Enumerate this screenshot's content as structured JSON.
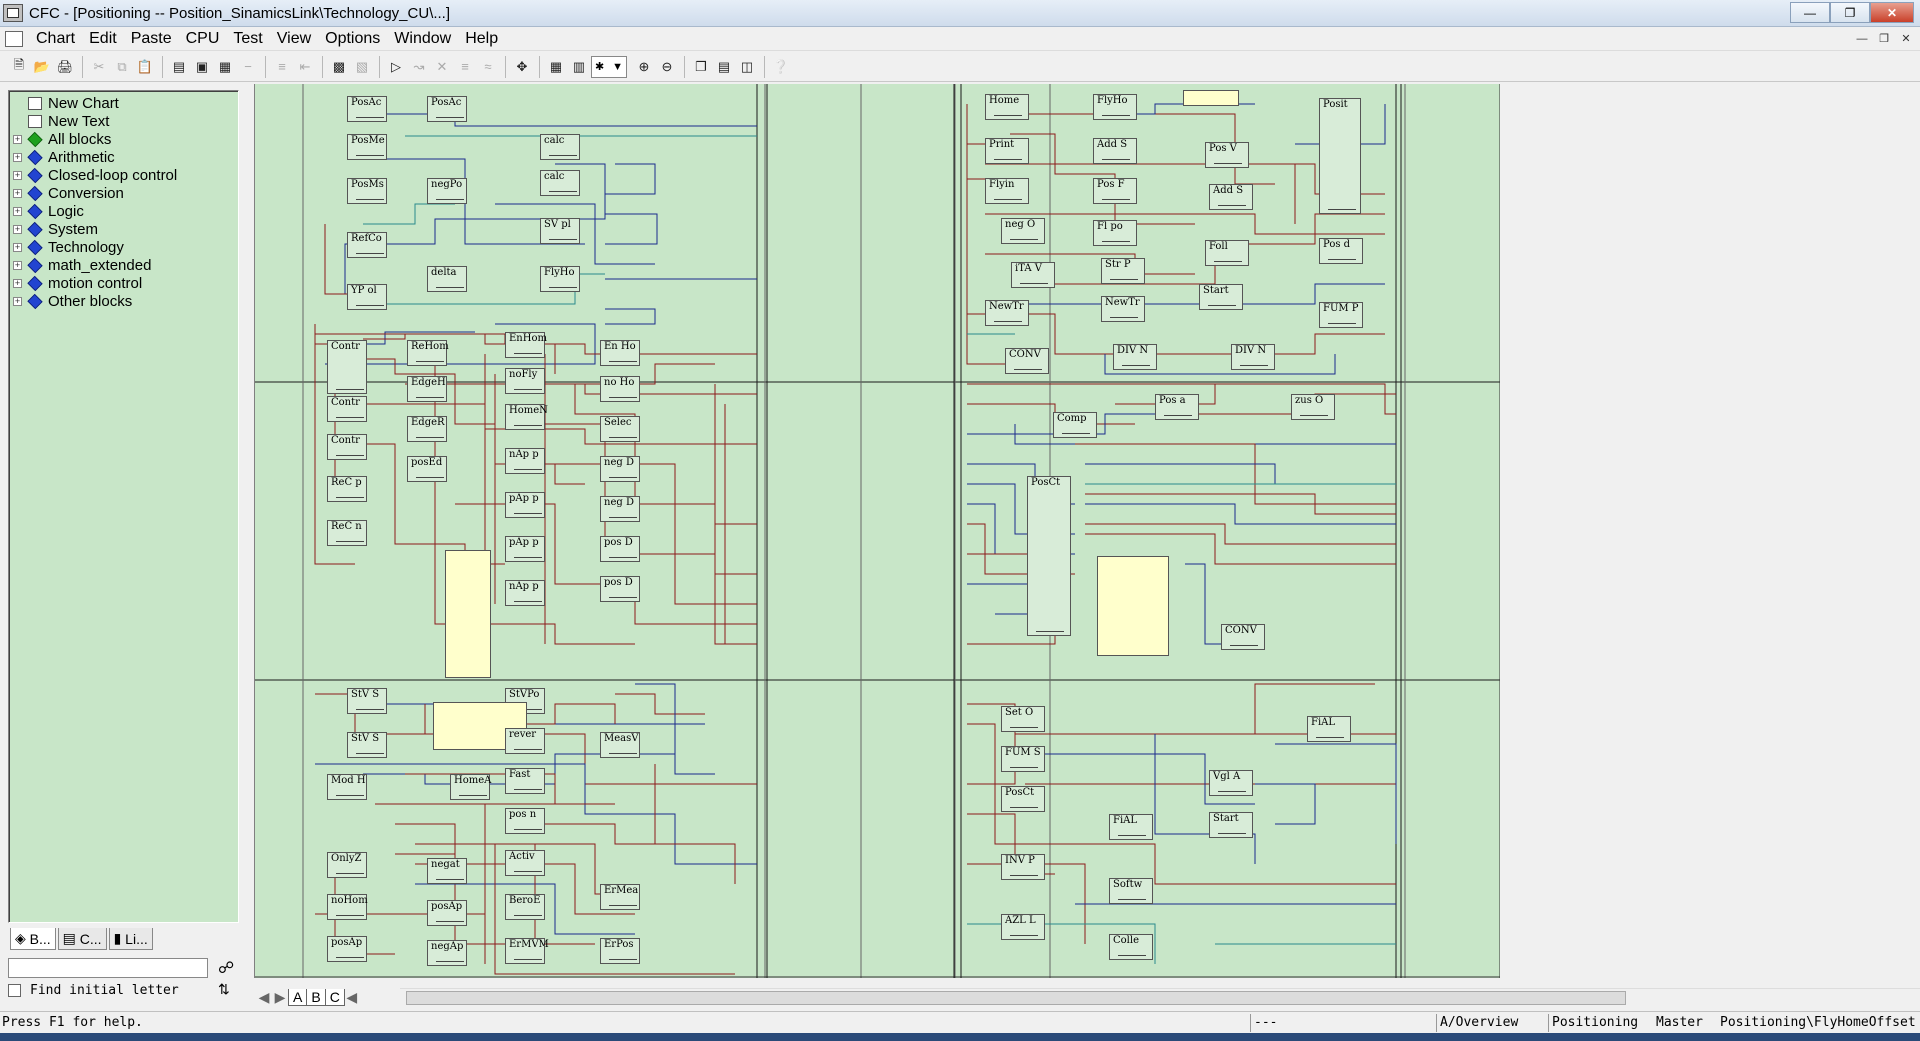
{
  "window": {
    "title": "CFC - [Positioning -- Position_SinamicsLink\\Technology_CU\\...]"
  },
  "menu": [
    {
      "label": "Chart"
    },
    {
      "label": "Edit"
    },
    {
      "label": "Paste"
    },
    {
      "label": "CPU"
    },
    {
      "label": "Test"
    },
    {
      "label": "View"
    },
    {
      "label": "Options"
    },
    {
      "label": "Window"
    },
    {
      "label": "Help"
    }
  ],
  "tree": [
    {
      "label": "New Chart",
      "icon": "chart-icon",
      "expandable": false
    },
    {
      "label": "New Text",
      "icon": "text-icon",
      "expandable": false
    },
    {
      "label": "All blocks",
      "icon": "green-block-icon",
      "expandable": true
    },
    {
      "label": "Arithmetic",
      "icon": "blue-block-icon",
      "expandable": true
    },
    {
      "label": "Closed-loop control",
      "icon": "blue-block-icon",
      "expandable": true
    },
    {
      "label": "Conversion",
      "icon": "blue-block-icon",
      "expandable": true
    },
    {
      "label": "Logic",
      "icon": "blue-block-icon",
      "expandable": true
    },
    {
      "label": "System",
      "icon": "blue-block-icon",
      "expandable": true
    },
    {
      "label": "Technology",
      "icon": "blue-block-icon",
      "expandable": true
    },
    {
      "label": "math_extended",
      "icon": "blue-block-icon",
      "expandable": true
    },
    {
      "label": "motion control",
      "icon": "blue-block-icon",
      "expandable": true
    },
    {
      "label": "Other blocks",
      "icon": "blue-block-icon",
      "expandable": true
    }
  ],
  "panel_tabs": [
    {
      "label": "B..."
    },
    {
      "label": "C..."
    },
    {
      "label": "Li..."
    }
  ],
  "find": {
    "checkbox_label": "Find initial letter",
    "value": ""
  },
  "sheet_tabs": [
    {
      "label": "A"
    },
    {
      "label": "B"
    },
    {
      "label": "C"
    }
  ],
  "blocks": {
    "b1": "PosAc",
    "b2": "PosAc",
    "b3": "PosMe",
    "b4": "calc",
    "b5": "calc",
    "b6": "PosMs",
    "b7": "negPo",
    "b8": "SV pl",
    "b9": "RefCo",
    "b10": "delta",
    "b11": "FlyHo",
    "b12": "YP ol",
    "c1": "Contr",
    "c2": "ReHom",
    "c3": "EnHom",
    "c4": "En Ho",
    "c5": "noFly",
    "c6": "EdgeH",
    "c7": "no Ho",
    "c8": "Contr",
    "c9": "HomeN",
    "c10": "EdgeR",
    "c11": "Selec",
    "c12": "Contr",
    "c13": "posEd",
    "c14": "nAp p",
    "c15": "neg D",
    "c16": "ReC p",
    "c17": "pAp p",
    "c18": "neg D",
    "c19": "ReC n",
    "c20": "pAp p",
    "c21": "pos D",
    "c22": "nAp p",
    "c23": "pos D",
    "d1": "StV S",
    "d2": "StVPo",
    "d3": "StV S",
    "d4": "rever",
    "d5": "MeasV",
    "d6": "Mod H",
    "d7": "HomeA",
    "d8": "Fast",
    "d9": "pos n",
    "d10": "OnlyZ",
    "d11": "negat",
    "d12": "Activ",
    "d13": "noHom",
    "d14": "posAp",
    "d15": "BeroE",
    "d16": "ErMea",
    "d17": "posAp",
    "d18": "negAp",
    "d19": "ErMVM",
    "d20": "ErPos",
    "e1": "Home",
    "e2": "FlyHo",
    "e3": "Posit",
    "e4": "Print",
    "e5": "Add S",
    "e6": "Pos V",
    "e7": "Flyin",
    "e8": "Pos F",
    "e9": "Add S",
    "e10": "neg O",
    "e11": "Fl po",
    "e12": "Foll",
    "e13": "Pos d",
    "e14": "iTA V",
    "e15": "Str P",
    "e16": "Start",
    "e17": "NewTr",
    "e18": "NewTr",
    "e19": "FUM P",
    "e20": "CONV",
    "e21": "DIV N",
    "e22": "DIV N",
    "f1": "Pos a",
    "f2": "zus O",
    "f3": "Comp",
    "f4": "PosCt",
    "f5": "CONV",
    "g1": "Set O",
    "g2": "FiAL",
    "g3": "FUM S",
    "g4": "Vgl A",
    "g5": "PosCt",
    "g6": "FiAL",
    "g7": "Start",
    "g8": "INV P",
    "g9": "Softw",
    "g10": "AZL L",
    "g11": "Colle"
  },
  "status": {
    "help": "Press F1 for help.",
    "field2": "---",
    "sheet": "A/Overview",
    "chart": "Positioning",
    "mode": "Master",
    "path": "Positioning\\FlyHomeOffset"
  },
  "colors": {
    "canvas": "#c8e6c8",
    "wire_red": "#8b1a1a",
    "wire_blue": "#1a2a8b",
    "wire_teal": "#2a8b8b",
    "comment_box": "#ffffcc"
  }
}
